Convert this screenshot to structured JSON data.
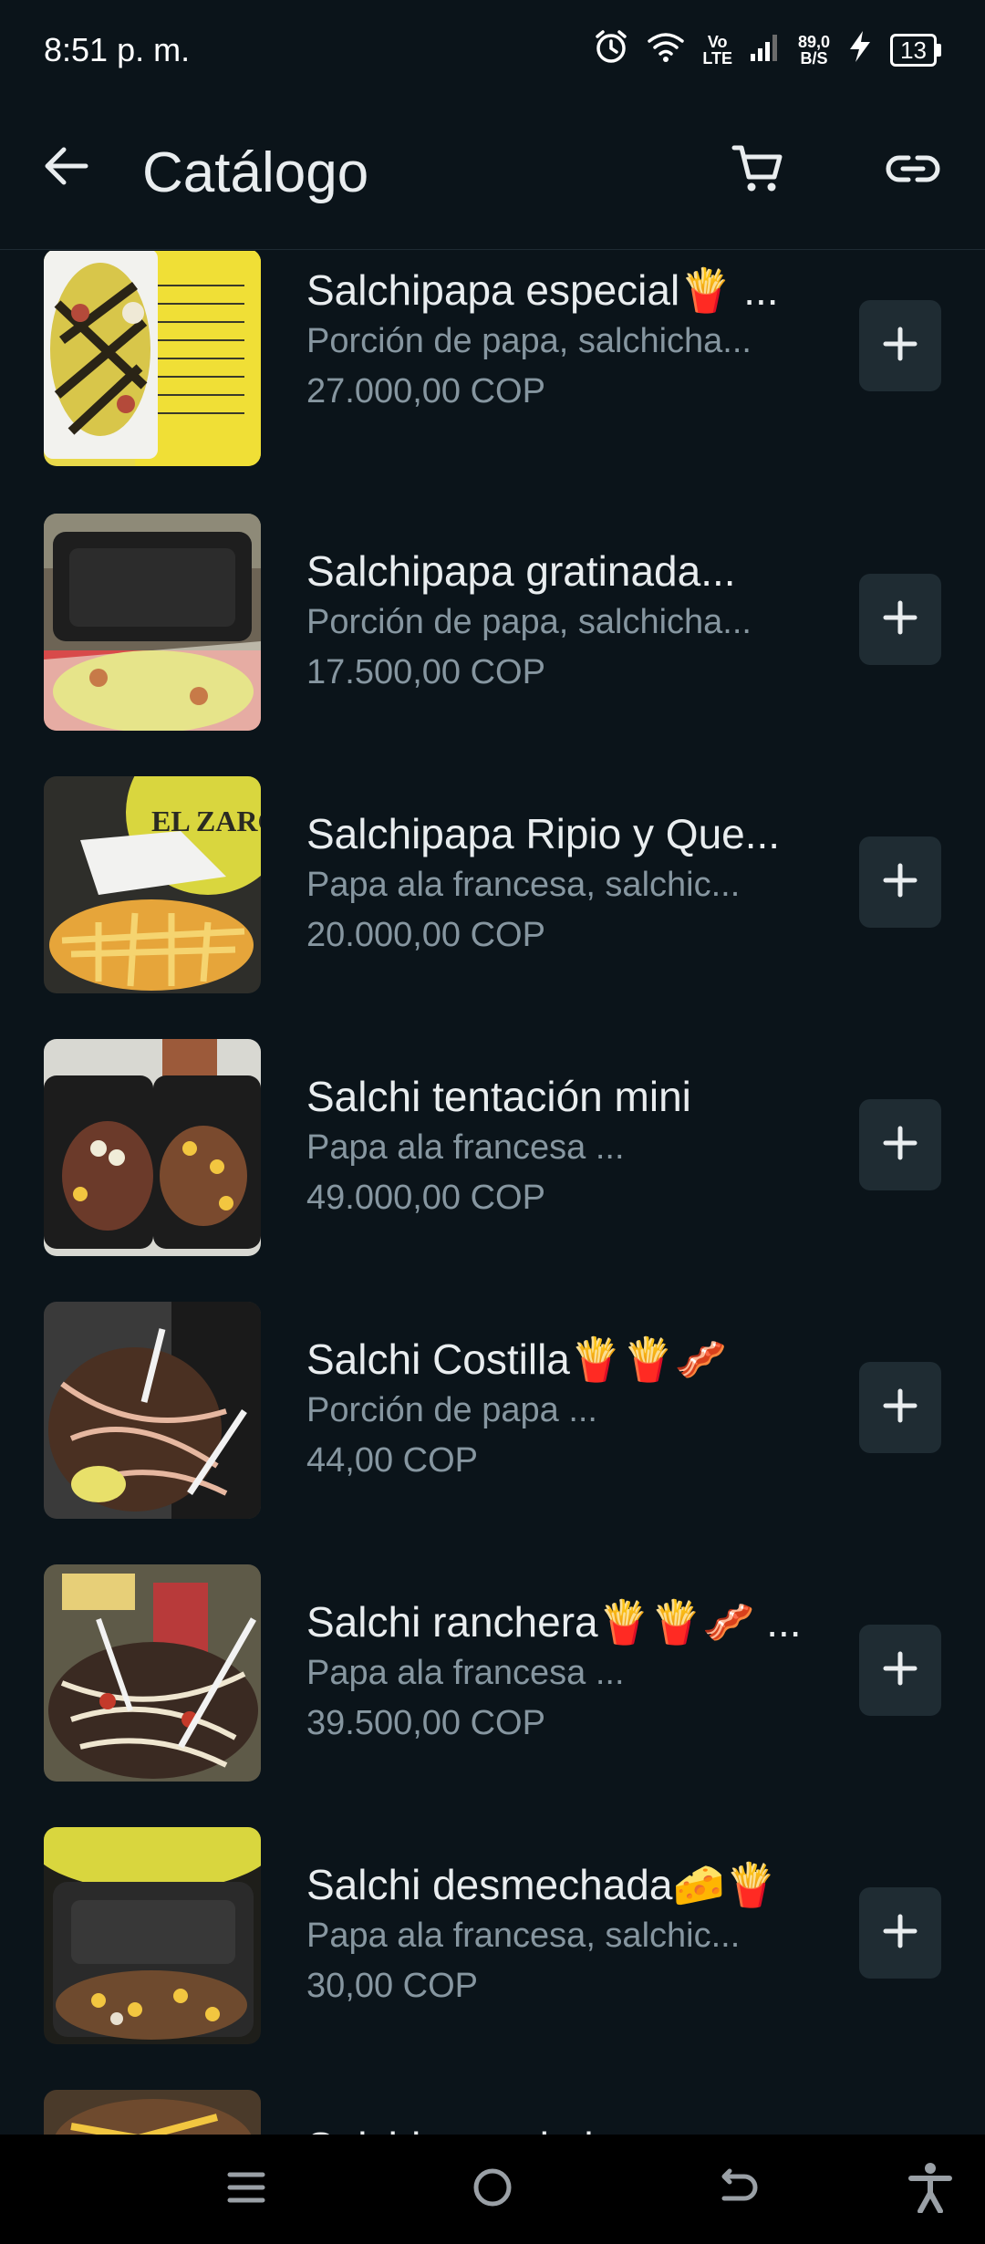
{
  "status_bar": {
    "time": "8:51 p. m.",
    "volte_top": "Vo",
    "volte_bottom": "LTE",
    "speed_top": "89,0",
    "speed_bottom": "B/S",
    "battery": "13"
  },
  "toolbar": {
    "title": "Catálogo"
  },
  "items": [
    {
      "name": "Salchipapa especial🍟 ...",
      "desc": "Porción de papa, salchicha...",
      "price": "27.000,00 COP"
    },
    {
      "name": "Salchipapa gratinada...",
      "desc": "Porción de papa, salchicha...",
      "price": "17.500,00 COP"
    },
    {
      "name": "Salchipapa Ripio y Que...",
      "desc": "Papa ala francesa, salchic...",
      "price": "20.000,00 COP"
    },
    {
      "name": "Salchi tentación mini",
      "desc": "Papa ala francesa ...",
      "price": "49.000,00 COP"
    },
    {
      "name": "Salchi Costilla🍟🍟🥓",
      "desc": "Porción de papa ...",
      "price": "44,00 COP"
    },
    {
      "name": "Salchi ranchera🍟🍟🥓 ...",
      "desc": "Papa ala francesa ...",
      "price": "39.500,00 COP"
    },
    {
      "name": "Salchi desmechada🧀🍟",
      "desc": "Papa ala francesa, salchic...",
      "price": "30,00 COP"
    },
    {
      "name": "Salchipapa de la casa...",
      "desc": "",
      "price": ""
    }
  ],
  "thumb_label": "EL ZARCO",
  "icons": {
    "back": "arrow-left-icon",
    "cart": "cart-icon",
    "link": "link-icon",
    "add": "plus-icon",
    "nav_menu": "menu-icon",
    "nav_home": "home-circle-icon",
    "nav_back": "back-icon",
    "nav_accessibility": "accessibility-icon"
  },
  "colors": {
    "background": "#0b141a",
    "text_primary": "#e9edef",
    "text_secondary": "#8696a0",
    "add_button": "#1f2c33"
  }
}
